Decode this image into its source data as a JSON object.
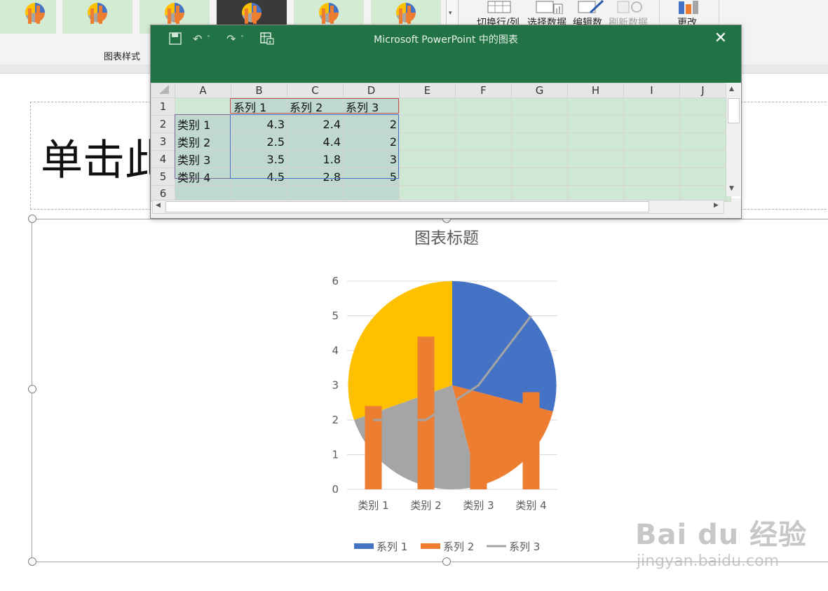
{
  "ribbon": {
    "group_label": "图表样式",
    "buttons": [
      {
        "label": "切换行/列",
        "dim": false
      },
      {
        "label": "选择数据",
        "dim": false
      },
      {
        "label": "编辑数",
        "dim": false
      },
      {
        "label": "刷新数据",
        "dim": true
      },
      {
        "label": "更改",
        "dim": false
      }
    ]
  },
  "slide": {
    "title_placeholder": "单击此"
  },
  "excel_window": {
    "title": "Microsoft PowerPoint 中的图表",
    "close_glyph": "✕",
    "columns": [
      "A",
      "B",
      "C",
      "D",
      "E",
      "F",
      "G",
      "H",
      "I",
      "J"
    ],
    "rows": [
      {
        "num": "1",
        "cells": [
          "",
          "系列 1",
          "系列 2",
          "系列 3",
          "",
          "",
          "",
          "",
          "",
          ""
        ]
      },
      {
        "num": "2",
        "cells": [
          "类别 1",
          "4.3",
          "2.4",
          "2",
          "",
          "",
          "",
          "",
          "",
          ""
        ]
      },
      {
        "num": "3",
        "cells": [
          "类别 2",
          "2.5",
          "4.4",
          "2",
          "",
          "",
          "",
          "",
          "",
          ""
        ]
      },
      {
        "num": "4",
        "cells": [
          "类别 3",
          "3.5",
          "1.8",
          "3",
          "",
          "",
          "",
          "",
          "",
          ""
        ]
      },
      {
        "num": "5",
        "cells": [
          "类别 4",
          "4.5",
          "2.8",
          "5",
          "",
          "",
          "",
          "",
          "",
          ""
        ]
      },
      {
        "num": "6",
        "cells": [
          "",
          "",
          "",
          "",
          "",
          "",
          "",
          "",
          "",
          ""
        ]
      }
    ]
  },
  "colors": {
    "series1": "#4472c4",
    "series2": "#ed7d31",
    "series3": "#a5a5a5",
    "slice4": "#ffc000",
    "excel_green": "#217346"
  },
  "chart_data": {
    "type": "bar",
    "title": "图表标题",
    "categories": [
      "类别 1",
      "类别 2",
      "类别 3",
      "类别 4"
    ],
    "ylim": [
      0,
      6
    ],
    "yticks": [
      0,
      1,
      2,
      3,
      4,
      5,
      6
    ],
    "grid": true,
    "legend_position": "bottom",
    "series": [
      {
        "name": "系列 1",
        "type": "pie",
        "values": [
          4.3,
          2.5,
          3.5,
          4.5
        ]
      },
      {
        "name": "系列 2",
        "type": "bar",
        "values": [
          2.4,
          4.4,
          1.8,
          2.8
        ]
      },
      {
        "name": "系列 3",
        "type": "line",
        "values": [
          2,
          2,
          3,
          5
        ]
      }
    ]
  },
  "watermark": {
    "logo": "Bai du 经验",
    "url": "jingyan.baidu.com"
  }
}
